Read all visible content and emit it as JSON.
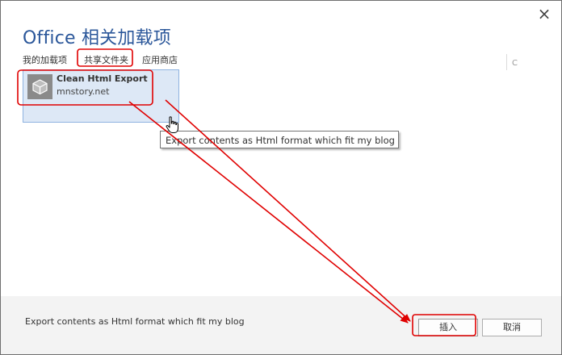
{
  "dialog": {
    "title": "Office 相关加载项",
    "close_glyph": "×"
  },
  "tabs": [
    {
      "label": "我的加载项"
    },
    {
      "label": "共享文件夹",
      "selected": true
    },
    {
      "label": "应用商店"
    }
  ],
  "sidebar_fragment": "C",
  "addin": {
    "name": "Clean Html Export",
    "publisher": "mnstory.net",
    "icon": "add-in-package-icon"
  },
  "tooltip": {
    "text": "Export contents as Html format which fit my blog"
  },
  "footer": {
    "description": "Export contents as Html format which fit my blog",
    "insert_label": "插入",
    "cancel_label": "取消"
  },
  "colors": {
    "title_blue": "#2b579a",
    "tile_selected_bg": "#dde8f6",
    "tile_selected_border": "#8fb3e0",
    "footer_bg": "#f3f3f3",
    "annotation_red": "#e00000"
  }
}
